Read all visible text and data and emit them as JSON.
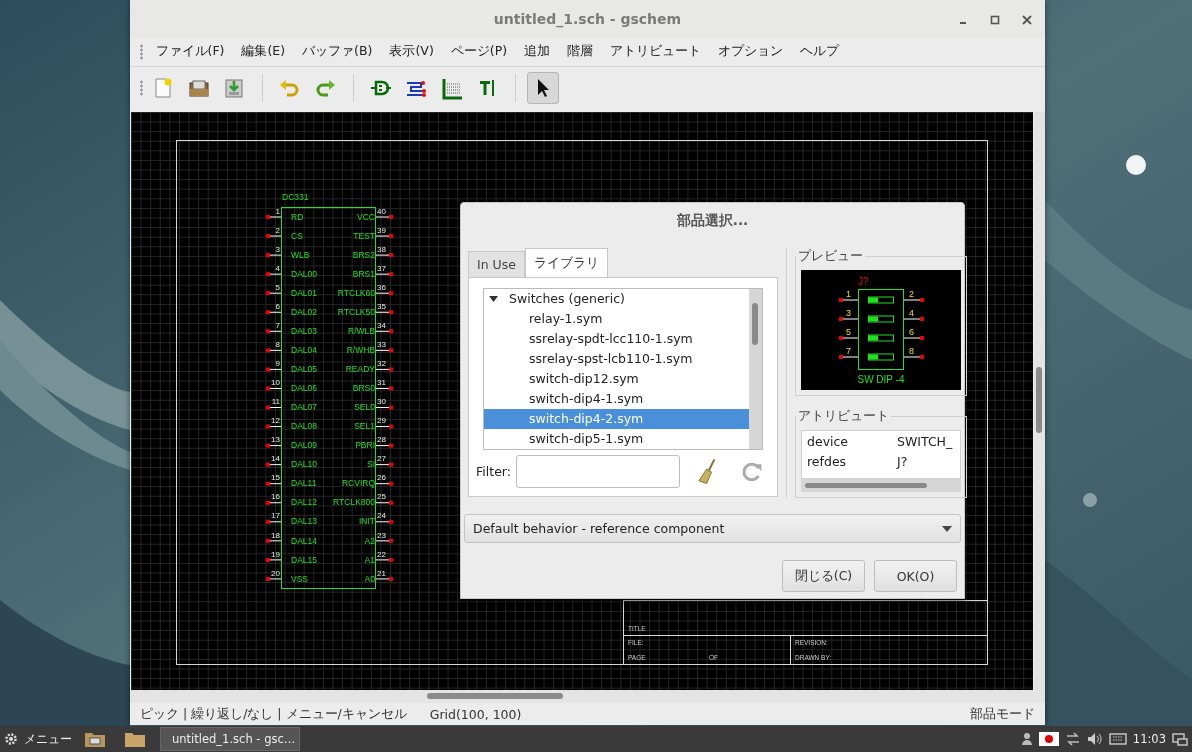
{
  "window": {
    "title": "untitled_1.sch - gschem"
  },
  "menu": [
    "ファイル(F)",
    "編集(E)",
    "バッファ(B)",
    "表示(V)",
    "ページ(P)",
    "追加",
    "階層",
    "アトリビュート",
    "オプション",
    "ヘルプ"
  ],
  "toolbar": [
    {
      "kind": "new",
      "selected": false
    },
    {
      "kind": "open",
      "selected": false
    },
    {
      "kind": "save",
      "selected": false
    },
    {
      "kind": "undo",
      "selected": false
    },
    {
      "kind": "redo",
      "selected": false
    },
    {
      "kind": "component",
      "selected": false
    },
    {
      "kind": "net",
      "selected": false
    },
    {
      "kind": "bus",
      "selected": false
    },
    {
      "kind": "text",
      "selected": false
    },
    {
      "kind": "select",
      "selected": true
    }
  ],
  "schematic": {
    "component": {
      "refdes": "DC331",
      "left_pins": [
        {
          "number": "1",
          "name": "RD"
        },
        {
          "number": "2",
          "name": "CS"
        },
        {
          "number": "3",
          "name": "WLB"
        },
        {
          "number": "4",
          "name": "DAL00"
        },
        {
          "number": "5",
          "name": "DAL01"
        },
        {
          "number": "6",
          "name": "DAL02"
        },
        {
          "number": "7",
          "name": "DAL03"
        },
        {
          "number": "8",
          "name": "DAL04"
        },
        {
          "number": "9",
          "name": "DAL05"
        },
        {
          "number": "10",
          "name": "DAL06"
        },
        {
          "number": "11",
          "name": "DAL07"
        },
        {
          "number": "12",
          "name": "DAL08"
        },
        {
          "number": "13",
          "name": "DAL09"
        },
        {
          "number": "14",
          "name": "DAL10"
        },
        {
          "number": "15",
          "name": "DAL11"
        },
        {
          "number": "16",
          "name": "DAL12"
        },
        {
          "number": "17",
          "name": "DAL13"
        },
        {
          "number": "18",
          "name": "DAL14"
        },
        {
          "number": "19",
          "name": "DAL15"
        },
        {
          "number": "20",
          "name": "VSS"
        }
      ],
      "right_pins": [
        {
          "number": "40",
          "name": "VCC"
        },
        {
          "number": "39",
          "name": "TEST"
        },
        {
          "number": "38",
          "name": "BRS2"
        },
        {
          "number": "37",
          "name": "BRS1"
        },
        {
          "number": "36",
          "name": "RTCLK60"
        },
        {
          "number": "35",
          "name": "RTCLK50"
        },
        {
          "number": "34",
          "name": "R/WLB"
        },
        {
          "number": "33",
          "name": "R/WHB"
        },
        {
          "number": "32",
          "name": "READY"
        },
        {
          "number": "31",
          "name": "BRS0"
        },
        {
          "number": "30",
          "name": "SEL0"
        },
        {
          "number": "29",
          "name": "SEL1"
        },
        {
          "number": "28",
          "name": "PBRI"
        },
        {
          "number": "27",
          "name": "SI"
        },
        {
          "number": "26",
          "name": "RCVIRQ"
        },
        {
          "number": "25",
          "name": "RTCLK800"
        },
        {
          "number": "24",
          "name": "INIT"
        },
        {
          "number": "23",
          "name": "A2"
        },
        {
          "number": "22",
          "name": "A1"
        },
        {
          "number": "21",
          "name": "A0"
        }
      ]
    },
    "title_block": {
      "title": "TITLE",
      "file": "FILE:",
      "page": "PAGE",
      "of": "OF",
      "revision": "REVISION:",
      "drawn_by": "DRAWN BY:"
    }
  },
  "dialog": {
    "title": "部品選択...",
    "tabs": [
      {
        "label": "In Use",
        "selected": false
      },
      {
        "label": "ライブラリ",
        "selected": true
      }
    ],
    "tree": [
      {
        "label": "Switches (generic)",
        "expanded": true,
        "children": [
          {
            "label": "relay-1.sym",
            "selected": false
          },
          {
            "label": "ssrelay-spdt-lcc110-1.sym",
            "selected": false
          },
          {
            "label": "ssrelay-spst-lcb110-1.sym",
            "selected": false
          },
          {
            "label": "switch-dip12.sym",
            "selected": false
          },
          {
            "label": "switch-dip4-1.sym",
            "selected": false
          },
          {
            "label": "switch-dip4-2.sym",
            "selected": true
          },
          {
            "label": "switch-dip5-1.sym",
            "selected": false
          }
        ]
      }
    ],
    "filter": {
      "label": "Filter:"
    },
    "preview": {
      "heading": "プレビュー",
      "refdes": "J?",
      "pins": [
        "1",
        "2",
        "3",
        "4",
        "5",
        "6",
        "7",
        "8"
      ],
      "label": "SW DIP -4"
    },
    "attributes": {
      "heading": "アトリビュート",
      "rows": [
        {
          "name": "device",
          "value": "SWITCH_"
        },
        {
          "name": "refdes",
          "value": "J?"
        }
      ]
    },
    "behavior": "Default behavior - reference component",
    "buttons": [
      "閉じる(C)",
      "OK(O)"
    ]
  },
  "status_bar": {
    "mode_hint": "ピック | 繰り返し/なし | メニュー/キャンセル",
    "grid": "Grid(100, 100)",
    "mode": "部品モード"
  },
  "taskbar": {
    "menu": "メニュー",
    "task": "untitled_1.sch - gsc…",
    "clock": "11:03"
  }
}
